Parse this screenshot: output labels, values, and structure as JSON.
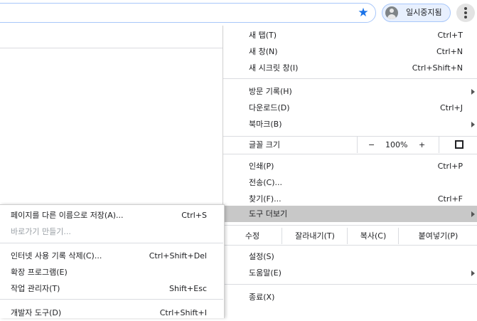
{
  "profile": {
    "label": "일시중지됨"
  },
  "menu": {
    "new_tab": {
      "label": "새 탭(T)",
      "shortcut": "Ctrl+T"
    },
    "new_window": {
      "label": "새 창(N)",
      "shortcut": "Ctrl+N"
    },
    "incognito": {
      "label": "새 시크릿 창(I)",
      "shortcut": "Ctrl+Shift+N"
    },
    "history": {
      "label": "방문 기록(H)"
    },
    "downloads": {
      "label": "다운로드(D)",
      "shortcut": "Ctrl+J"
    },
    "bookmarks": {
      "label": "북마크(B)"
    },
    "zoom": {
      "label": "글꼴 크기",
      "minus": "−",
      "value": "100%",
      "plus": "+"
    },
    "print": {
      "label": "인쇄(P)",
      "shortcut": "Ctrl+P"
    },
    "cast": {
      "label": "전송(C)..."
    },
    "find": {
      "label": "찾기(F)...",
      "shortcut": "Ctrl+F"
    },
    "more_tools": {
      "label": "도구 더보기"
    },
    "edit": {
      "label": "수정",
      "cut": "잘라내기(T)",
      "copy": "복사(C)",
      "paste": "붙여넣기(P)"
    },
    "settings": {
      "label": "설정(S)"
    },
    "help": {
      "label": "도움말(E)"
    },
    "exit": {
      "label": "종료(X)"
    }
  },
  "submenu": {
    "save_page": {
      "label": "페이지를 다른 이름으로 저장(A)...",
      "shortcut": "Ctrl+S"
    },
    "create_shortcut": {
      "label": "바로가기 만들기..."
    },
    "clear_data": {
      "label": "인터넷 사용 기록 삭제(C)...",
      "shortcut": "Ctrl+Shift+Del"
    },
    "extensions": {
      "label": "확장 프로그램(E)"
    },
    "task_manager": {
      "label": "작업 관리자(T)",
      "shortcut": "Shift+Esc"
    },
    "dev_tools": {
      "label": "개발자 도구(D)",
      "shortcut": "Ctrl+Shift+I"
    }
  },
  "colors": {
    "accent": "#1a73e8",
    "highlight": "#c8c8c8",
    "profile_bg": "#e8f0fe"
  },
  "icons": {
    "star": "star-icon",
    "avatar": "avatar-icon",
    "menu": "kebab-menu-icon",
    "fullscreen": "fullscreen-icon",
    "arrow": "chevron-right-icon"
  }
}
